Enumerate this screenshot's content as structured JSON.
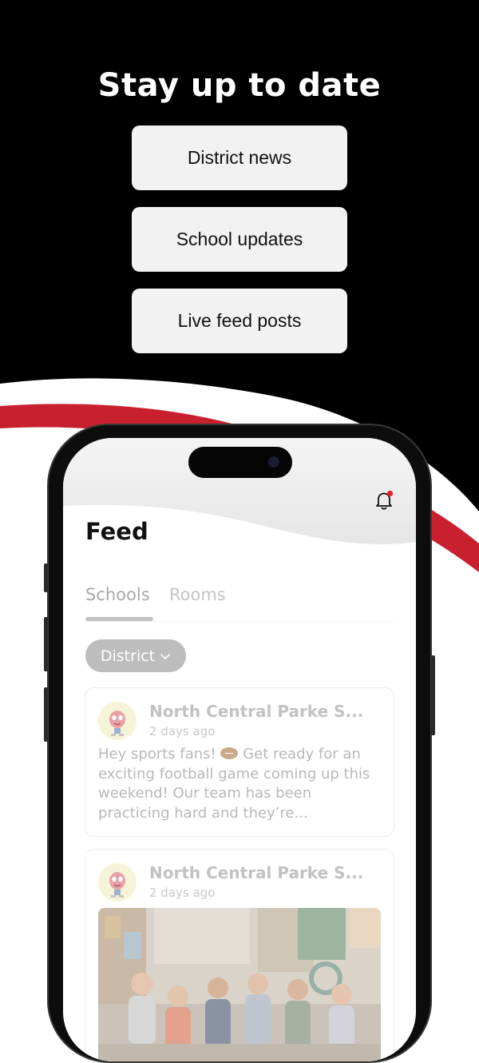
{
  "promo": {
    "headline": "Stay up to date",
    "features": [
      "District news",
      "School updates",
      "Live feed posts"
    ]
  },
  "colors": {
    "background_dark": "#000000",
    "accent_red": "#c8202f",
    "card_bg": "#f2f2f2"
  },
  "app": {
    "title": "Feed",
    "notification_icon": "bell-icon",
    "notification_badge": true,
    "tabs": [
      {
        "label": "Schools",
        "selected": true
      },
      {
        "label": "Rooms",
        "selected": false
      }
    ],
    "filter": {
      "selected": "District",
      "icon": "chevron-down-icon"
    },
    "posts": [
      {
        "author": "North Central Parke S...",
        "time": "2 days ago",
        "text_before_emoji": "Hey sports fans! ",
        "emoji": "football-emoji",
        "text_after_emoji": " Get ready for an exciting football game coming up this weekend! Our team has been practicing hard and they’re...",
        "has_photo": false
      },
      {
        "author": "North Central Parke S...",
        "time": "2 days ago",
        "has_photo": true
      }
    ]
  }
}
